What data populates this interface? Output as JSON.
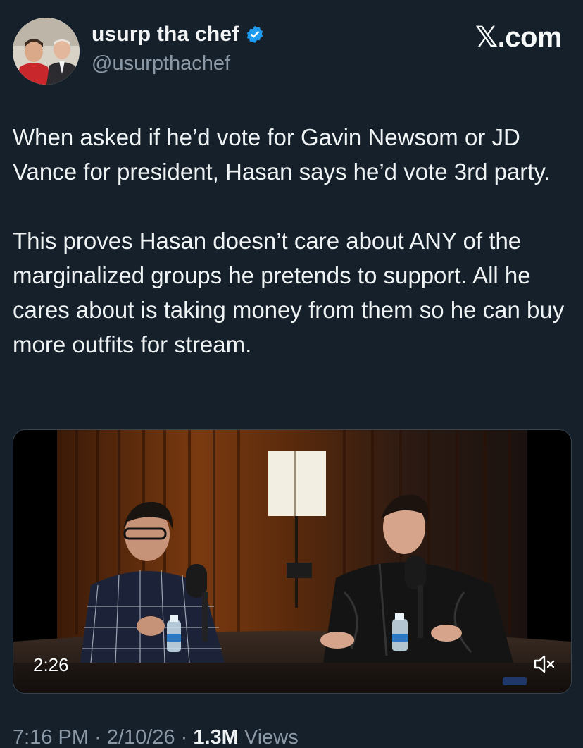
{
  "author": {
    "display_name": "usurp tha chef",
    "handle": "@usurpthachef",
    "verified_icon": "verified-badge-icon",
    "verified_color": "#1d9bf0"
  },
  "brand": {
    "label": ".com",
    "logo_icon": "x-logo-icon"
  },
  "tweet": {
    "paragraph_1": "When asked if he’d vote for Gavin Newsom or JD Vance for president, Hasan says he’d vote 3rd party.",
    "paragraph_2": "This proves Hasan doesn’t care about ANY of the marginalized groups he pretends to support. All he cares about is taking money from them so he can buy more outfits for stream."
  },
  "video": {
    "duration": "2:26",
    "mute_icon": "speaker-muted-icon"
  },
  "meta": {
    "time": "7:16 PM",
    "separator": "·",
    "date": "2/10/26",
    "views_count": "1.3M",
    "views_label": "Views"
  },
  "colors": {
    "background": "#15202b",
    "text": "#eff3f4",
    "secondary_text": "#8b98a5",
    "accent": "#1d9bf0"
  }
}
